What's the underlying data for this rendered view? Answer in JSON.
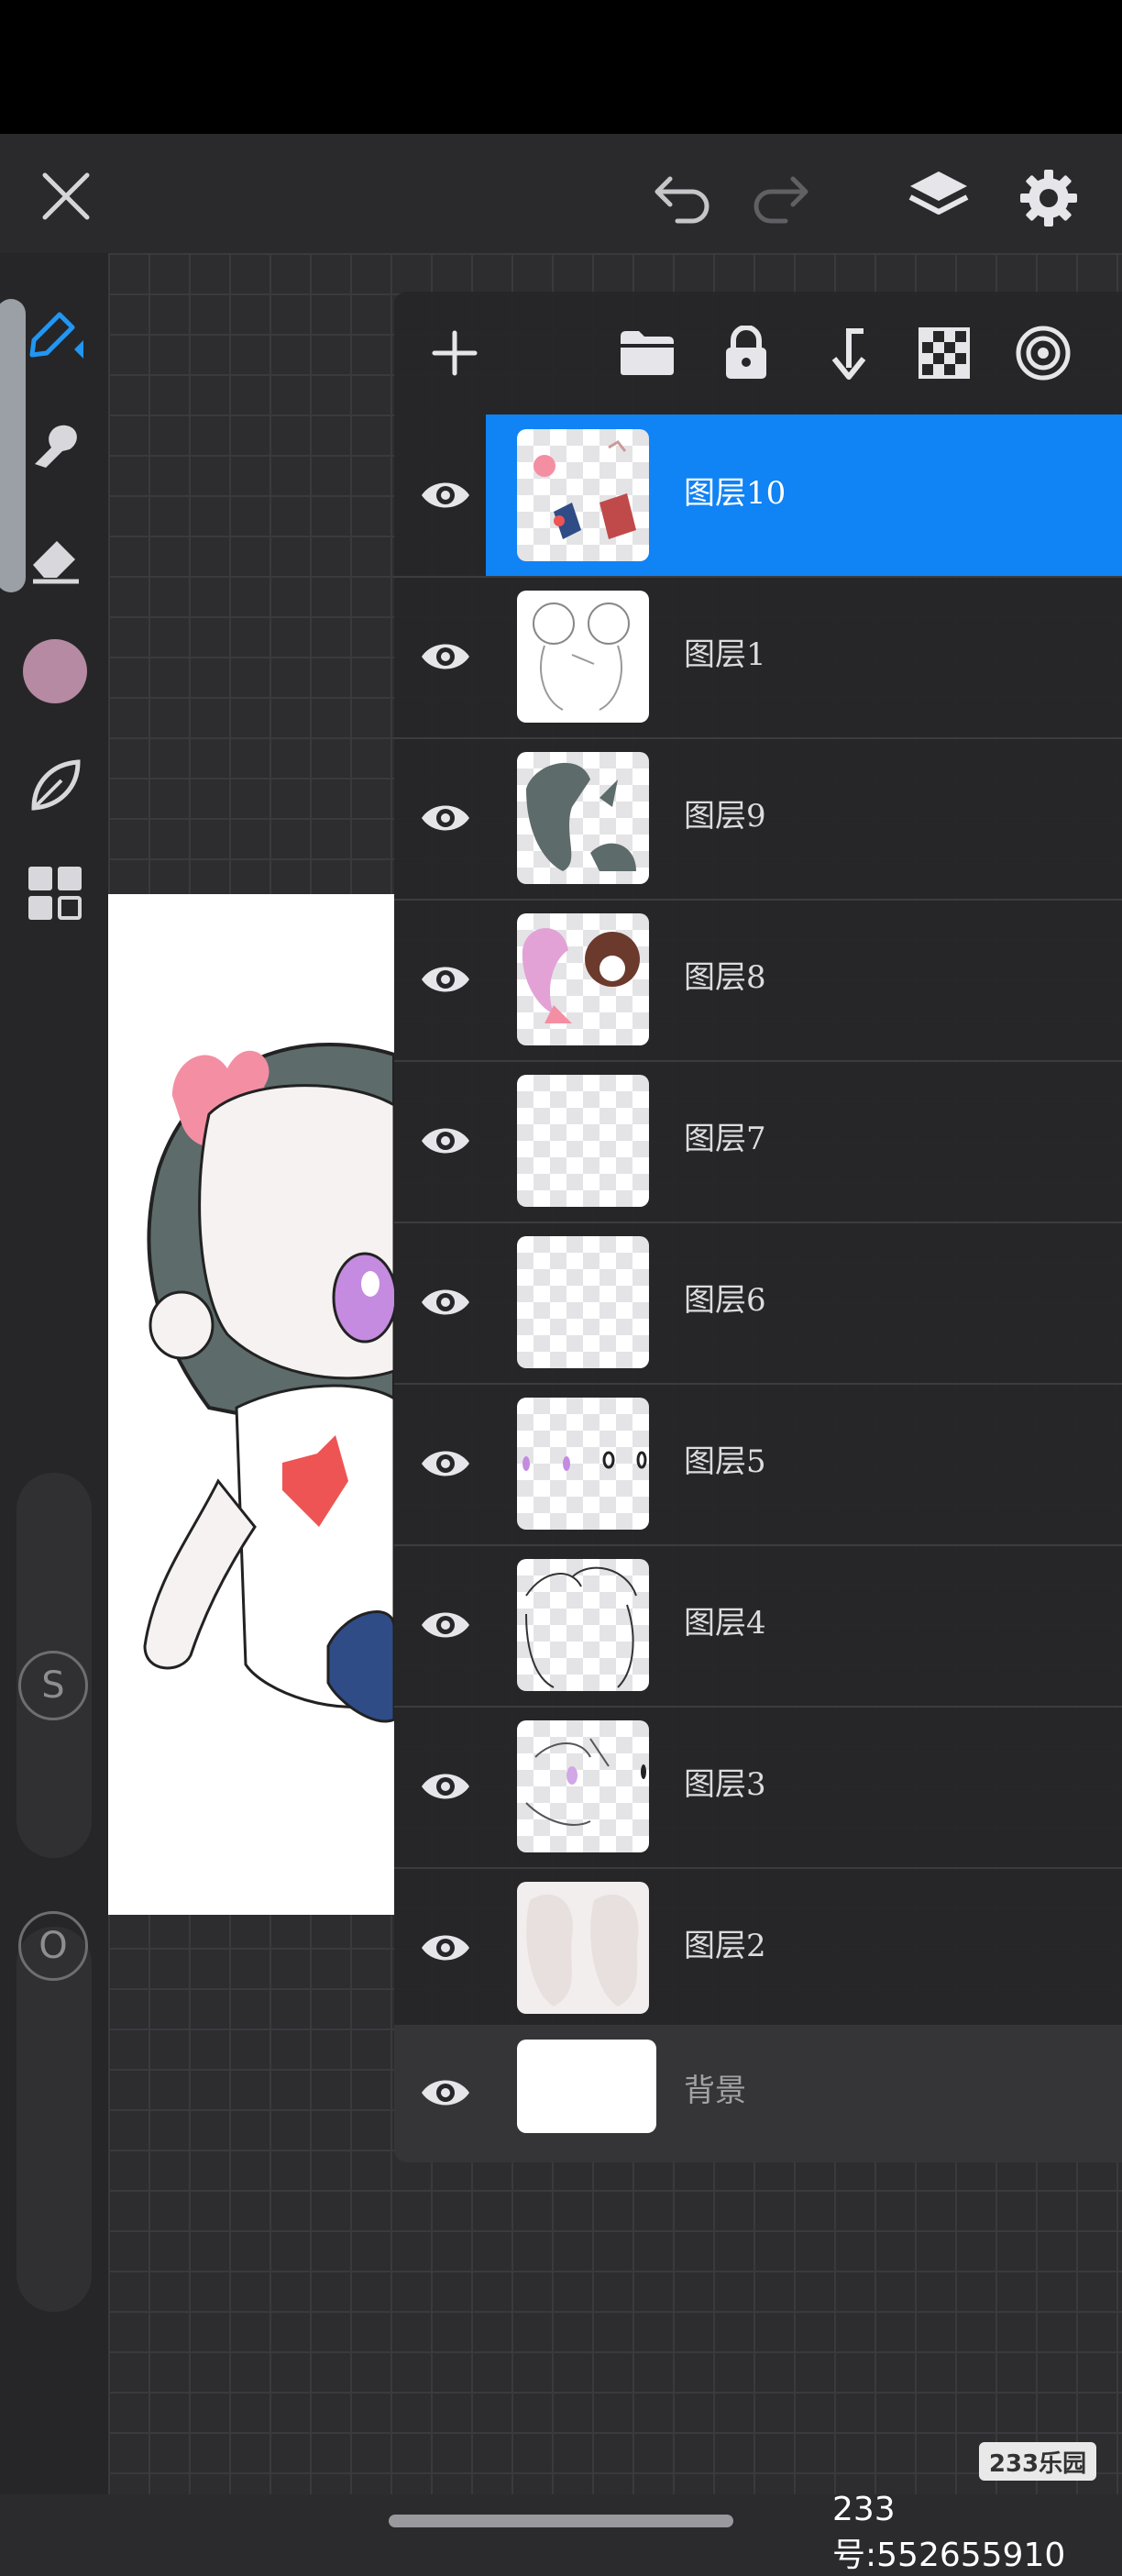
{
  "app": {
    "accent": "#1083f5",
    "brush_color": "#b68aa2"
  },
  "topbar": {
    "close": "close-icon",
    "undo": "undo-icon",
    "redo": "redo-icon",
    "layers": "layers-icon",
    "settings": "gear-icon"
  },
  "left_tools": {
    "size_letter": "S",
    "opacity_letter": "O"
  },
  "layers_toolbar": [
    "add-layer-icon",
    "folder-icon",
    "lock-icon",
    "merge-down-icon",
    "transparency-icon",
    "blend-icon"
  ],
  "layers": [
    {
      "name": "图层10",
      "selected": true
    },
    {
      "name": "图层1",
      "selected": false
    },
    {
      "name": "图层9",
      "selected": false
    },
    {
      "name": "图层8",
      "selected": false
    },
    {
      "name": "图层7",
      "selected": false
    },
    {
      "name": "图层6",
      "selected": false
    },
    {
      "name": "图层5",
      "selected": false
    },
    {
      "name": "图层4",
      "selected": false
    },
    {
      "name": "图层3",
      "selected": false
    },
    {
      "name": "图层2",
      "selected": false
    }
  ],
  "background_layer": {
    "name": "背景"
  },
  "watermark": {
    "logo": "233乐园",
    "id_text": "233号:552655910"
  }
}
